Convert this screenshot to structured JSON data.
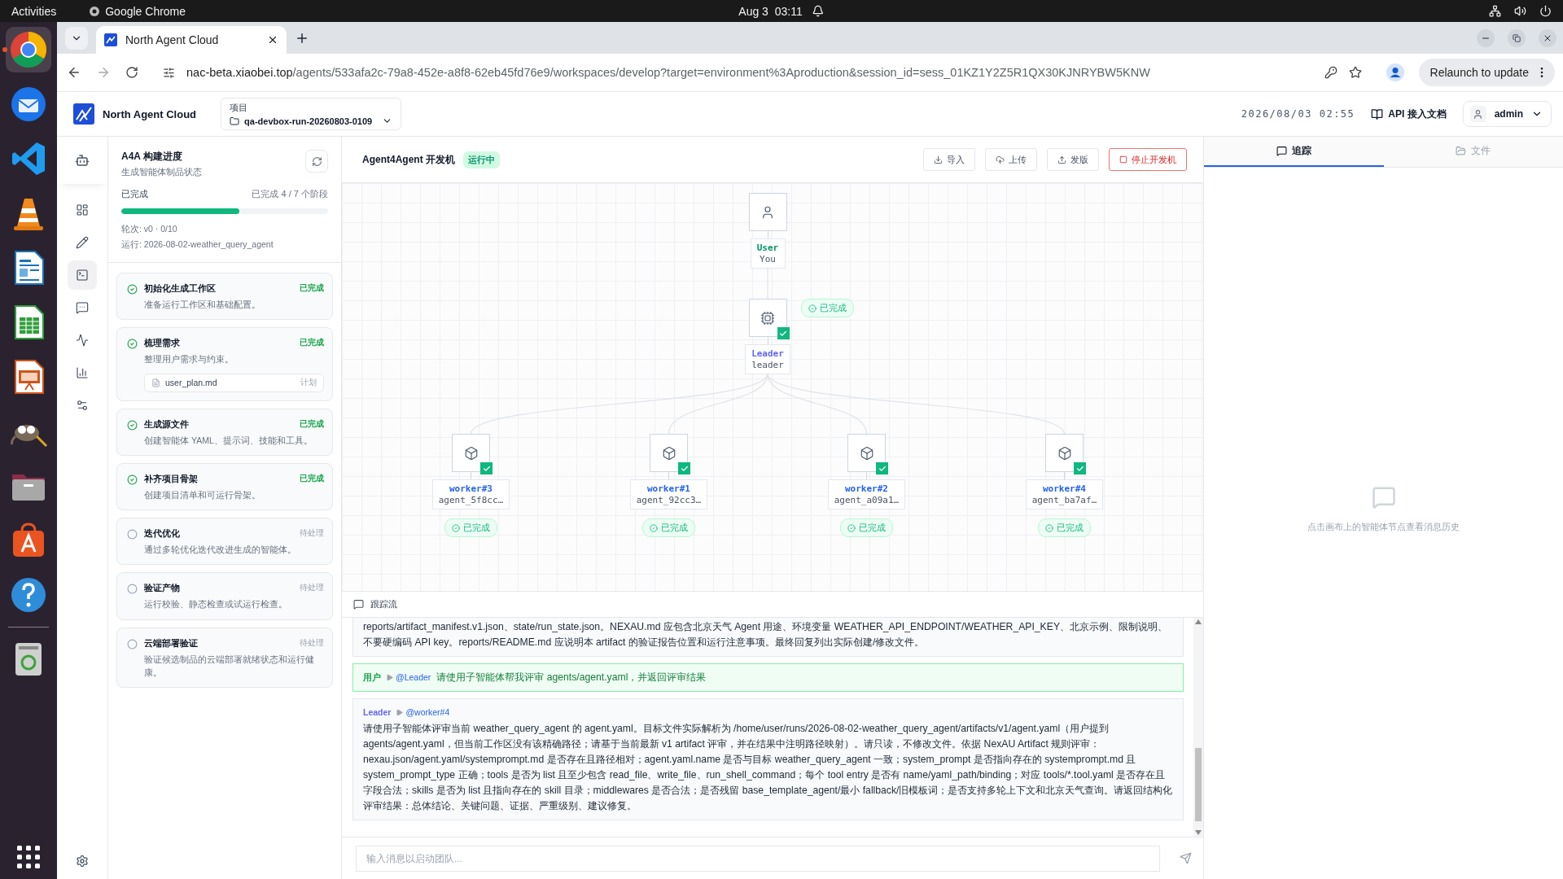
{
  "desktop": {
    "activities": "Activities",
    "app_name": "Google Chrome",
    "clock": "Aug 3  03:11"
  },
  "browser": {
    "tabs": [
      {
        "title": "North Agent Cloud",
        "selected": true
      }
    ],
    "url_host": "nac-beta.xiaobei.top",
    "url_path": "/agents/533afa2c-79a8-452e-a8f8-62eb45fd76e9/workspaces/develop?target=environment%3Aproduction&session_id=sess_01KZ1Y2Z5R1QX30KJNRYBW5KNW",
    "relaunch": "Relaunch to update"
  },
  "header": {
    "brand": "North Agent Cloud",
    "project_label": "项目",
    "project": "qa-devbox-run-20260803-0109",
    "datetime": "2026/08/03 02:55",
    "docs": "API 接入文档",
    "user": "admin"
  },
  "rail": [
    {
      "kind": "dashboard",
      "selected": false
    },
    {
      "kind": "edit",
      "selected": false
    },
    {
      "kind": "terminal",
      "selected": true
    },
    {
      "kind": "chat",
      "selected": false
    },
    {
      "kind": "activity",
      "selected": false
    },
    {
      "kind": "chart",
      "selected": false
    },
    {
      "kind": "controls",
      "selected": false
    }
  ],
  "progress": {
    "title": "A4A 构建进度",
    "subtitle": "生成智能体制品状态",
    "status": "已完成",
    "summary": "已完成 4 / 7 个阶段",
    "level": 0.57,
    "round": "轮次: v0 · 0/10",
    "run": "运行: 2026-08-02-weather_query_agent"
  },
  "stages": [
    {
      "title": "初始化生成工作区",
      "description": "准备运行工作区和基础配置。",
      "status": "已完成",
      "done": true
    },
    {
      "title": "梳理需求",
      "description": "整理用户需求与约束。",
      "status": "已完成",
      "done": true,
      "files": [
        {
          "name": "user_plan.md",
          "tag": "计划"
        }
      ]
    },
    {
      "title": "生成源文件",
      "description": "创建智能体 YAML、提示词、技能和工具。",
      "status": "已完成",
      "done": true
    },
    {
      "title": "补齐项目骨架",
      "description": "创建项目清单和可运行骨架。",
      "status": "已完成",
      "done": true
    },
    {
      "title": "迭代优化",
      "description": "通过多轮优化迭代改进生成的智能体。",
      "status": "待处理",
      "done": false
    },
    {
      "title": "验证产物",
      "description": "运行校验、静态检查或试运行检查。",
      "status": "待处理",
      "done": false
    },
    {
      "title": "云端部署验证",
      "description": "验证候选制品的云端部署就绪状态和运行健康。",
      "status": "待处理",
      "done": false
    }
  ],
  "workspace": {
    "title": "Agent4Agent 开发机",
    "state": "运行中",
    "actions": [
      {
        "kind": "import",
        "label": "导入"
      },
      {
        "kind": "upload",
        "label": "上传"
      },
      {
        "kind": "release",
        "label": "发版"
      }
    ],
    "stop": "停止开发机"
  },
  "graph": {
    "kind": "user",
    "name": "User",
    "id_label": "You",
    "children": [
      {
        "kind": "leader",
        "name": "Leader",
        "id_label": "leader",
        "done": true,
        "status": "已完成",
        "children": [
          {
            "kind": "worker",
            "name": "worker#3",
            "id_label": "agent_5f8cc…",
            "done": true,
            "status": "已完成"
          },
          {
            "kind": "worker",
            "name": "worker#1",
            "id_label": "agent_92cc3…",
            "done": true,
            "status": "已完成"
          },
          {
            "kind": "worker",
            "name": "worker#2",
            "id_label": "agent_a09a1…",
            "done": true,
            "status": "已完成"
          },
          {
            "kind": "worker",
            "name": "worker#4",
            "id_label": "agent_ba7af…",
            "done": true,
            "status": "已完成"
          }
        ]
      }
    ]
  },
  "trace": {
    "title": "跟踪流",
    "messages": [
      {
        "kind": "agent",
        "text": "reports/artifact_manifest.v1.json、state/run_state.json。NEXAU.md 应包含北京天气 Agent 用途、环境变量 WEATHER_API_ENDPOINT/WEATHER_API_KEY、北京示例、限制说明、不要硬编码 API key。reports/README.md 应说明本 artifact 的验证报告位置和运行注意事项。最终回复列出实际创建/修改文件。"
      },
      {
        "kind": "user",
        "sender": "用户",
        "target": "@Leader",
        "text": "请使用子智能体帮我评审 agents/agent.yaml，并返回评审结果"
      },
      {
        "kind": "agent",
        "sender": "Leader",
        "target": "@worker#4",
        "text": "请使用子智能体评审当前 weather_query_agent 的 agent.yaml。目标文件实际解析为 /home/user/runs/2026-08-02-weather_query_agent/artifacts/v1/agent.yaml（用户提到 agents/agent.yaml，但当前工作区没有该精确路径；请基于当前最新 v1 artifact 评审，并在结果中注明路径映射）。请只读，不修改文件。依据 NexAU Artifact 规则评审：nexau.json/agent.yaml/systemprompt.md 是否存在且路径相对；agent.yaml.name 是否与目标 weather_query_agent 一致；system_prompt 是否指向存在的 systemprompt.md 且 system_prompt_type 正确；tools 是否为 list 且至少包含 read_file、write_file、run_shell_command；每个 tool entry 是否有 name/yaml_path/binding；对应 tools/*.tool.yaml 是否存在且字段合法；skills 是否为 list 且指向存在的 skill 目录；middlewares 是否合法；是否残留 base_template_agent/最小 fallback/旧模板词；是否支持多轮上下文和北京天气查询。请返回结构化评审结果：总体结论、关键问题、证据、严重级别、建议修复。"
      }
    ],
    "input_placeholder": "输入消息以启动团队..."
  },
  "inspector": {
    "tabs": [
      {
        "kind": "trace",
        "label": "追踪",
        "selected": true
      },
      {
        "kind": "files",
        "label": "文件",
        "selected": false
      }
    ],
    "empty": "点击画布上的智能体节点查看消息历史"
  }
}
